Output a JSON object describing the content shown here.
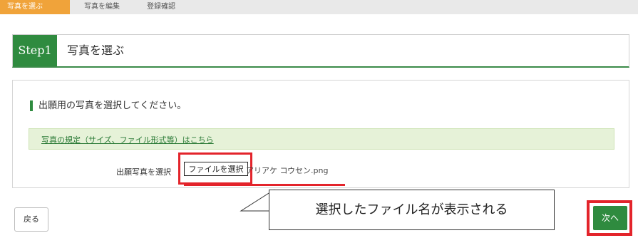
{
  "steps": [
    "写真を選ぶ",
    "写真を編集",
    "登録確認"
  ],
  "header": {
    "step": "Step1",
    "title": "写真を選ぶ"
  },
  "panel": {
    "instruction": "出願用の写真を選択してください。",
    "rules_link": "写真の規定（サイズ、ファイル形式等）はこちら",
    "file_label": "出願写真を選択",
    "file_button": "ファイルを選択",
    "file_name": "アリアケ コウセン.png"
  },
  "callout": "選択したファイル名が表示される",
  "buttons": {
    "back": "戻る",
    "next": "次へ"
  },
  "colors": {
    "step_active": "#f0a33a",
    "accent_green": "#2f8b3f",
    "highlight_red": "#e3242b"
  }
}
